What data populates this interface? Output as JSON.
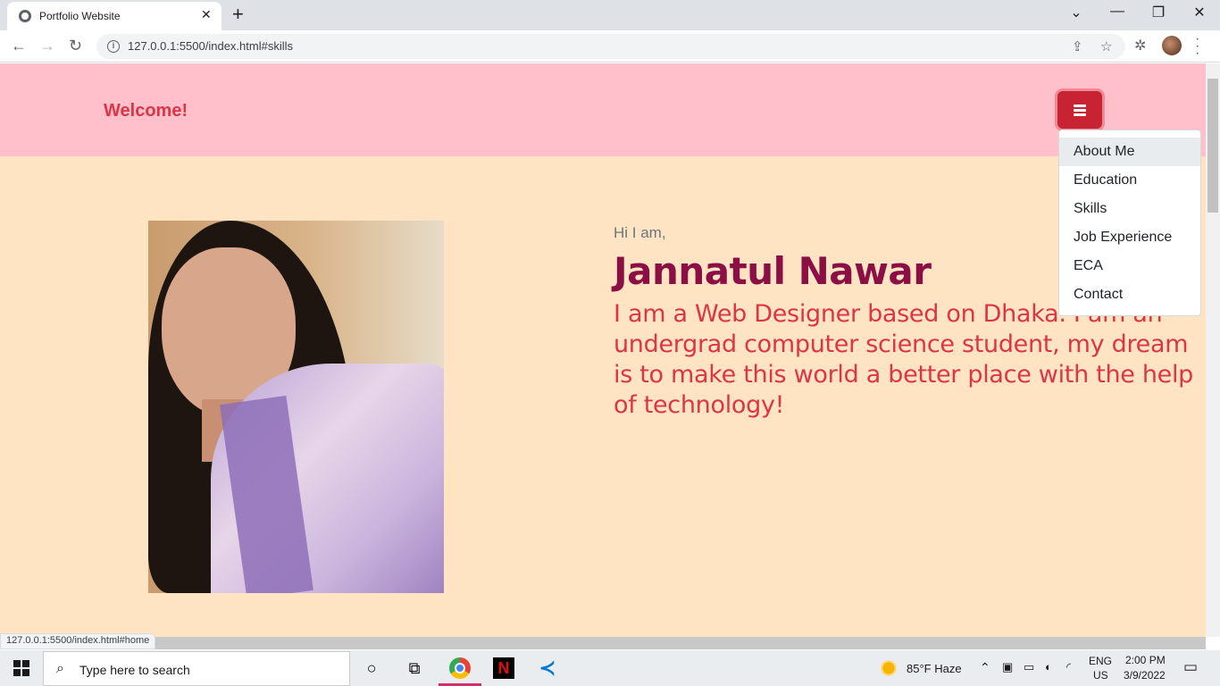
{
  "browser": {
    "tab_title": "Portfolio Website",
    "url": "127.0.0.1:5500/index.html#skills",
    "status_url": "127.0.0.1:5500/index.html#home"
  },
  "page": {
    "brand": "Welcome!",
    "menu": [
      {
        "label": "About Me",
        "active": true
      },
      {
        "label": "Education"
      },
      {
        "label": "Skills"
      },
      {
        "label": "Job Experience"
      },
      {
        "label": "ECA"
      },
      {
        "label": "Contact"
      }
    ],
    "greeting": "Hi I am,",
    "name": "Jannatul Nawar",
    "bio": "I am a Web Designer based on Dhaka. I am an undergrad computer science student, my dream is to make this world a better place with the help of technology!",
    "colors": {
      "navbar": "#ffc0cb",
      "body": "#ffe4c4",
      "brand": "#dc3545",
      "name": "#8b0f45"
    }
  },
  "taskbar": {
    "search_placeholder": "Type here to search",
    "weather": "85°F  Haze",
    "lang_top": "ENG",
    "lang_bottom": "US",
    "time": "2:00 PM",
    "date": "3/9/2022"
  }
}
